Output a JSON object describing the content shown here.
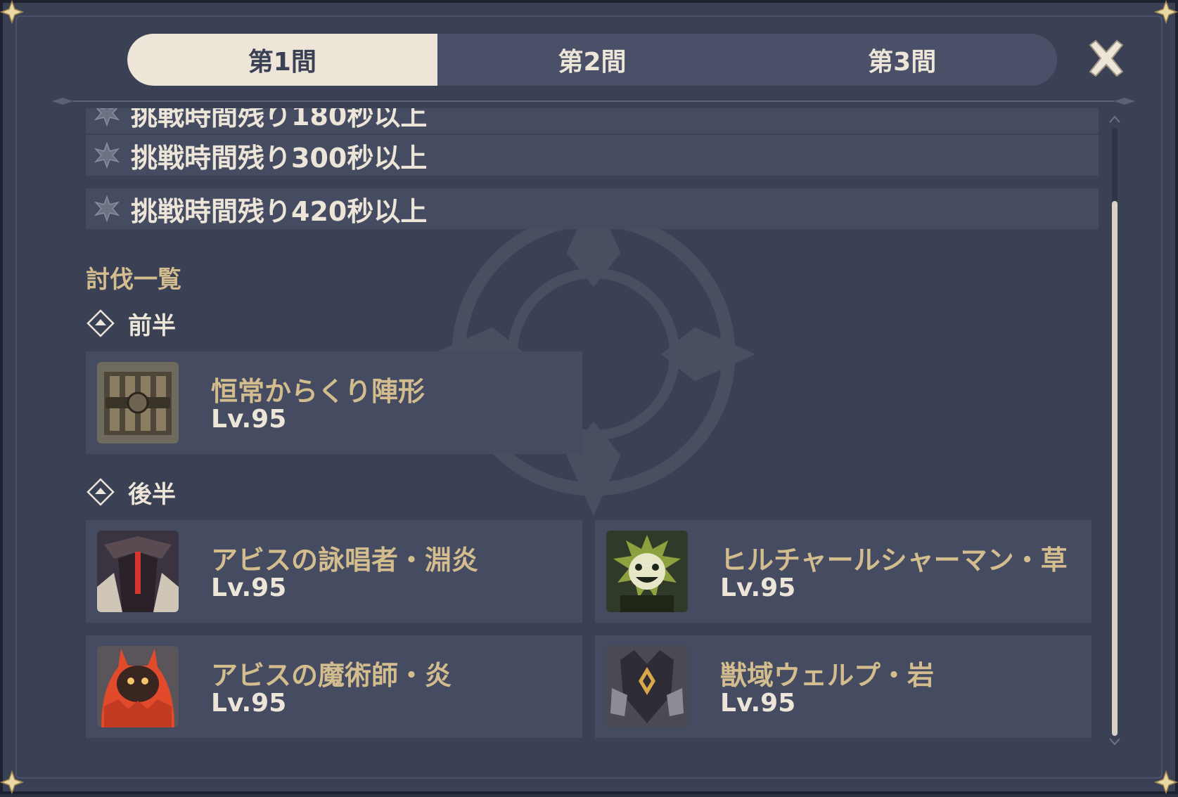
{
  "tabs": [
    {
      "label": "第1間",
      "active": true
    },
    {
      "label": "第2間",
      "active": false
    },
    {
      "label": "第3間",
      "active": false
    }
  ],
  "conditions": [
    {
      "text": "挑戦時間残り180秒以上"
    },
    {
      "text": "挑戦時間残り300秒以上"
    },
    {
      "text": "挑戦時間残り420秒以上"
    }
  ],
  "enemy_list": {
    "title": "討伐一覧",
    "first_half": {
      "label": "前半",
      "enemies": [
        {
          "name": "恒常からくり陣形",
          "level": "Lv.95"
        }
      ]
    },
    "second_half": {
      "label": "後半",
      "enemies": [
        {
          "name": "アビスの詠唱者・淵炎",
          "level": "Lv.95"
        },
        {
          "name": "ヒルチャールシャーマン・草",
          "level": "Lv.95"
        },
        {
          "name": "アビスの魔術師・炎",
          "level": "Lv.95"
        },
        {
          "name": "獣域ウェルプ・岩",
          "level": "Lv.95"
        }
      ]
    }
  },
  "colors": {
    "background": "#3b4155",
    "row": "#454b60",
    "gold": "#d3bc8e",
    "cream": "#ece5d8"
  },
  "icons": [
    "close-icon",
    "star-icon",
    "diamond-arrow-icon",
    "scroll-up-icon",
    "scroll-down-icon"
  ]
}
